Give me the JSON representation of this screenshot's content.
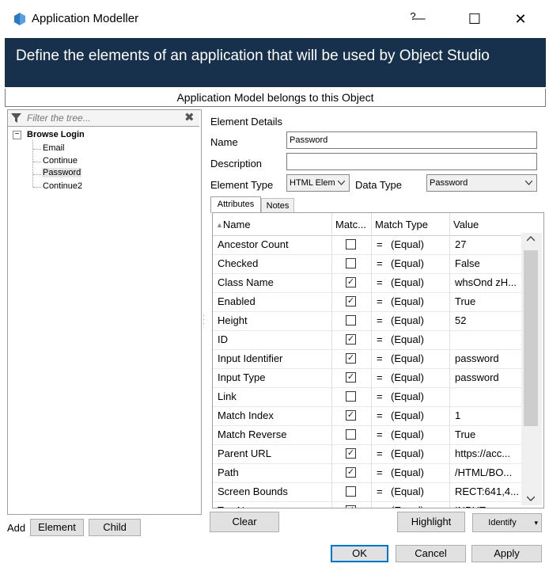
{
  "window": {
    "title": "Application Modeller",
    "help_glyph": "?",
    "minimize_glyph": "—",
    "maximize_glyph": "☐",
    "close_glyph": "✕"
  },
  "banner": {
    "text": "Define the elements of an application that will be used by Object Studio"
  },
  "belongs_label": "Application Model belongs to this Object",
  "tree": {
    "filter_placeholder": "Filter the tree...",
    "clear_glyph": "✖",
    "expander": "−",
    "root": "Browse Login",
    "children": [
      "Email",
      "Continue",
      "Password",
      "Continue2"
    ],
    "selected": "Password"
  },
  "left_buttons": {
    "add_label": "Add",
    "element": "Element",
    "child": "Child"
  },
  "details": {
    "section_title": "Element Details",
    "name_label": "Name",
    "name_value": "Password",
    "description_label": "Description",
    "description_value": "",
    "element_type_label": "Element Type",
    "element_type_value": "HTML Elem",
    "data_type_label": "Data Type",
    "data_type_value": "Password"
  },
  "tabs": {
    "attributes": "Attributes",
    "notes": "Notes"
  },
  "attributes": {
    "headers": {
      "name": "Name",
      "match": "Matc...",
      "match_type": "Match Type",
      "value": "Value"
    },
    "rows": [
      {
        "name": "Ancestor Count",
        "checked": false,
        "op": "=",
        "type": "(Equal)",
        "value": "27"
      },
      {
        "name": "Checked",
        "checked": false,
        "op": "=",
        "type": "(Equal)",
        "value": "False"
      },
      {
        "name": "Class Name",
        "checked": true,
        "op": "=",
        "type": "(Equal)",
        "value": "whsOnd zH..."
      },
      {
        "name": "Enabled",
        "checked": true,
        "op": "=",
        "type": "(Equal)",
        "value": "True"
      },
      {
        "name": "Height",
        "checked": false,
        "op": "=",
        "type": "(Equal)",
        "value": "52"
      },
      {
        "name": "ID",
        "checked": true,
        "op": "=",
        "type": "(Equal)",
        "value": ""
      },
      {
        "name": "Input Identifier",
        "checked": true,
        "op": "=",
        "type": "(Equal)",
        "value": "password"
      },
      {
        "name": "Input Type",
        "checked": true,
        "op": "=",
        "type": "(Equal)",
        "value": "password"
      },
      {
        "name": "Link",
        "checked": false,
        "op": "=",
        "type": "(Equal)",
        "value": ""
      },
      {
        "name": "Match Index",
        "checked": true,
        "op": "=",
        "type": "(Equal)",
        "value": "1"
      },
      {
        "name": "Match Reverse",
        "checked": false,
        "op": "=",
        "type": "(Equal)",
        "value": "True"
      },
      {
        "name": "Parent URL",
        "checked": true,
        "op": "=",
        "type": "(Equal)",
        "value": "https://acc..."
      },
      {
        "name": "Path",
        "checked": true,
        "op": "=",
        "type": "(Equal)",
        "value": "/HTML/BO..."
      },
      {
        "name": "Screen Bounds",
        "checked": false,
        "op": "=",
        "type": "(Equal)",
        "value": "RECT:641,4..."
      },
      {
        "name": "Tag Name",
        "checked": true,
        "op": "=",
        "type": "(Equal)",
        "value": "INPUT"
      }
    ]
  },
  "bottom": {
    "clear": "Clear",
    "highlight": "Highlight",
    "identify": "Identify",
    "ok": "OK",
    "cancel": "Cancel",
    "apply": "Apply"
  },
  "colors": {
    "banner_bg": "#17304b",
    "icon_blue": "#2b78c5"
  }
}
